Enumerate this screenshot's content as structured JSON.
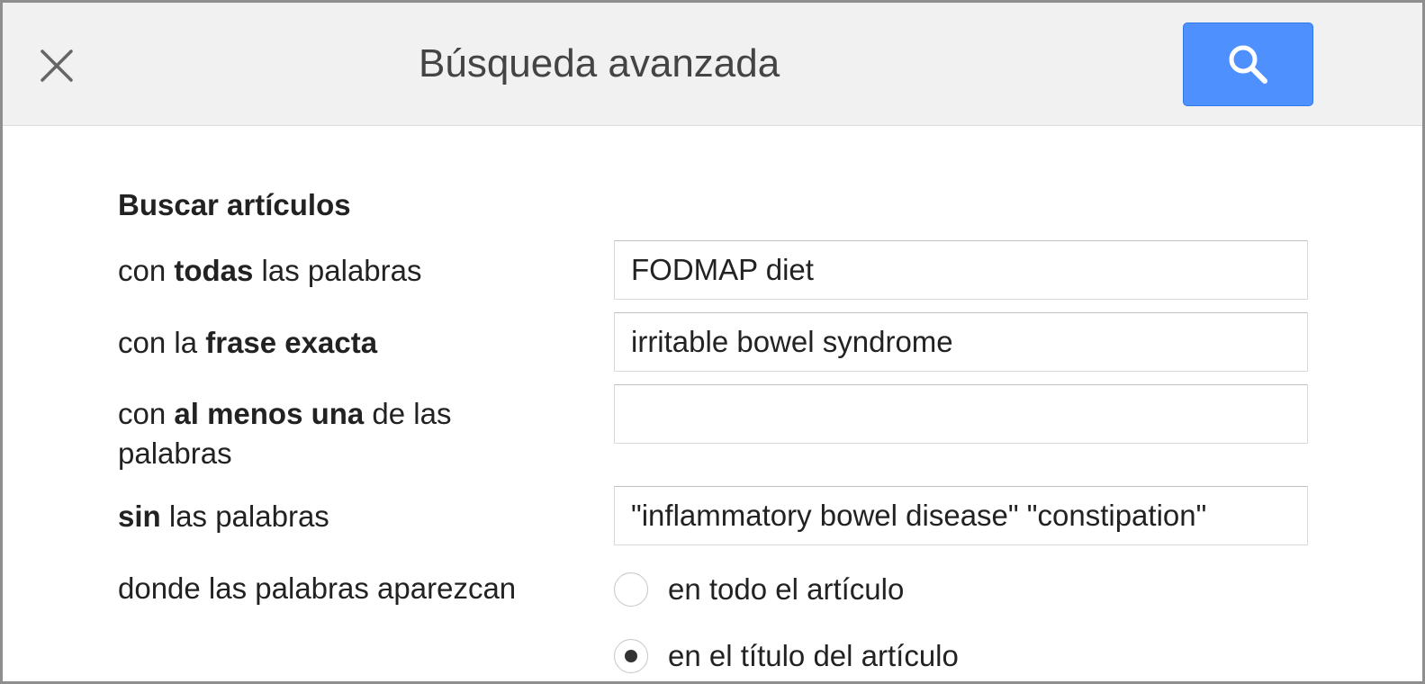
{
  "header": {
    "title": "Búsqueda avanzada",
    "close_icon": "close-icon",
    "search_icon": "search-icon",
    "search_button_color": "#4d90fe"
  },
  "form": {
    "heading": "Buscar artículos",
    "all_words": {
      "pre": "con ",
      "bold": "todas",
      "post": " las palabras",
      "value": "FODMAP diet"
    },
    "exact_phrase": {
      "pre": "con la ",
      "bold": "frase exacta",
      "post": "",
      "value": "irritable bowel syndrome"
    },
    "at_least_one": {
      "pre": "con ",
      "bold": "al menos una",
      "post": " de las palabras",
      "value": ""
    },
    "without_words": {
      "pre": "",
      "bold": "sin",
      "post": " las palabras",
      "value": "\"inflammatory bowel disease\" \"constipation\""
    },
    "where": {
      "label": "donde las palabras aparezcan",
      "options": [
        {
          "label": "en todo el artículo",
          "checked": false
        },
        {
          "label": "en el título del artículo",
          "checked": true
        }
      ]
    }
  }
}
